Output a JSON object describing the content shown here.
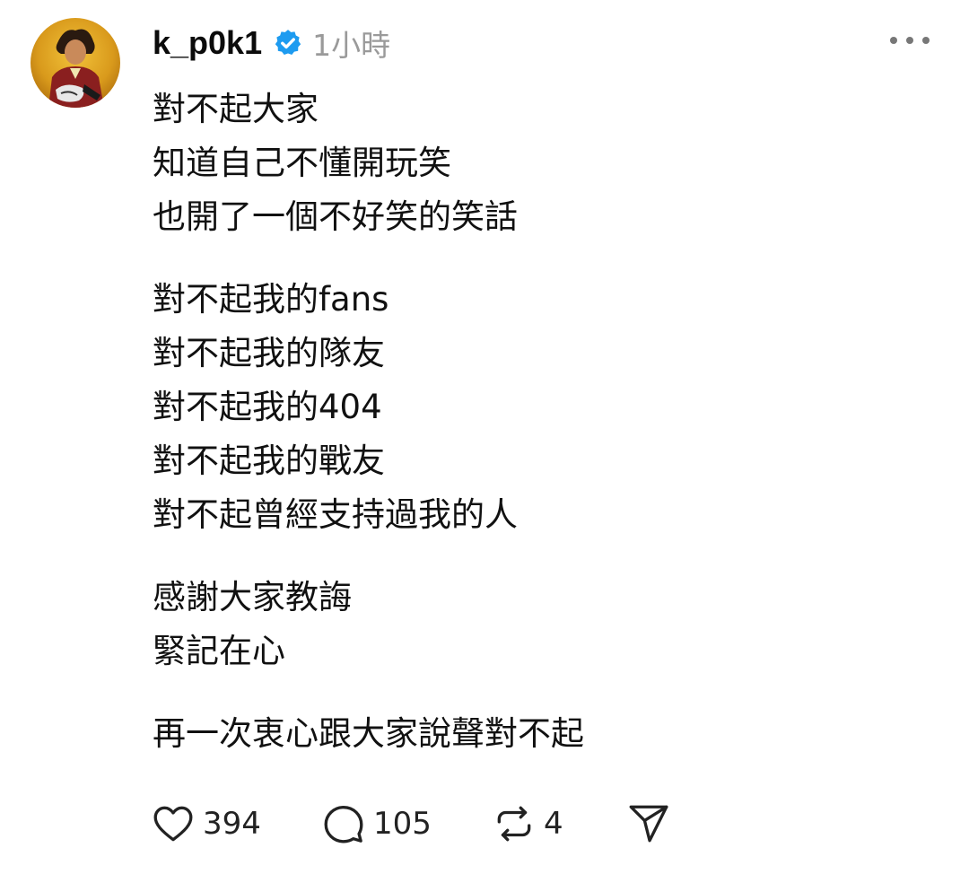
{
  "post": {
    "author": {
      "username": "k_p0k1",
      "verified": true,
      "avatar": "avatar-image"
    },
    "timestamp": "1小時",
    "paragraphs": [
      [
        "對不起大家",
        "知道自己不懂開玩笑",
        "也開了一個不好笑的笑話"
      ],
      [
        "對不起我的fans",
        "對不起我的隊友",
        "對不起我的404",
        "對不起我的戰友",
        "對不起曾經支持過我的人"
      ],
      [
        "感謝大家教誨",
        "緊記在心"
      ],
      [
        "再一次衷心跟大家說聲對不起"
      ]
    ],
    "stats": {
      "likes": "394",
      "replies": "105",
      "reposts": "4"
    }
  },
  "icons": {
    "verified": "verified-badge-icon",
    "more": "more-options-icon",
    "like": "heart-icon",
    "reply": "comment-bubble-icon",
    "repost": "repost-icon",
    "share": "send-icon"
  },
  "colors": {
    "verified_badge": "#1d9bf0",
    "timestamp": "#9a9a9a",
    "text": "#111111"
  }
}
